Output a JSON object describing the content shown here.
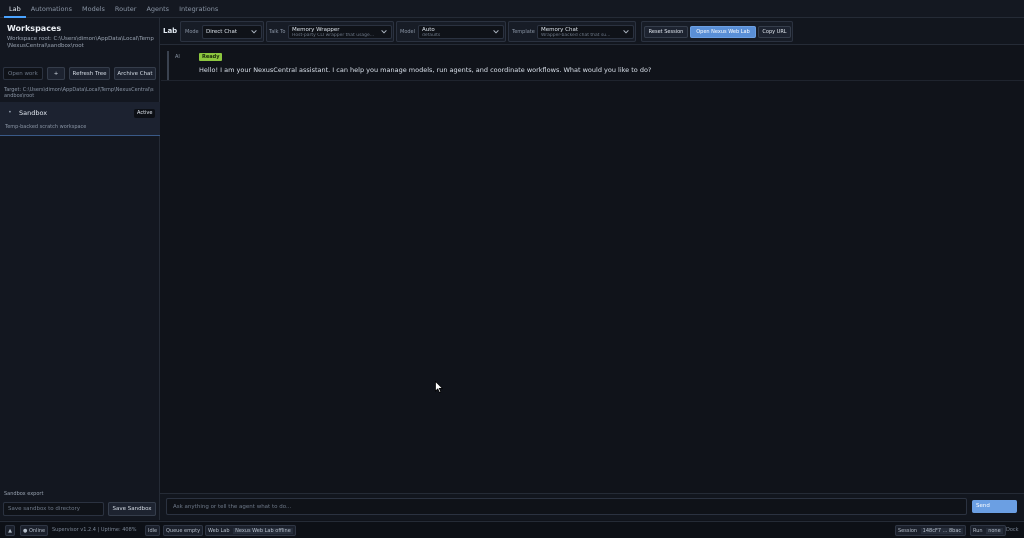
{
  "nav": {
    "tabs": [
      {
        "label": "Lab",
        "active": true
      },
      {
        "label": "Automations"
      },
      {
        "label": "Models"
      },
      {
        "label": "Router"
      },
      {
        "label": "Agents"
      },
      {
        "label": "Integrations"
      }
    ]
  },
  "sidebar": {
    "title": "Workspaces",
    "workspace_root": "Workspace root: C:\\Users\\dimon\\AppData\\Local\\Temp\\NexusCentral\\sandbox\\root",
    "open_workspace_placeholder": "Open work",
    "add_label": "+",
    "refresh_tree_label": "Refresh Tree",
    "archive_chat_label": "Archive Chat",
    "target": "Target: C:\\Users\\dimon\\AppData\\Local\\Temp\\NexusCentral\\sandbox\\root",
    "sandbox": {
      "bullet": "•",
      "name": "Sandbox",
      "status": "Active",
      "description": "Temp-backed scratch workspace"
    },
    "export_label": "Sandbox export",
    "save_dir_placeholder": "Save sandbox to directory",
    "save_sandbox_label": "Save Sandbox"
  },
  "toolbar": {
    "lab_label": "Lab",
    "mode": {
      "label": "Mode",
      "value": "Direct Chat"
    },
    "talk_to": {
      "label": "Talk To",
      "value": "Memory Wrapper",
      "sub": "Host-party CLI wrapper that usage..."
    },
    "model": {
      "label": "Model",
      "value": "Auto",
      "sub": "defaults"
    },
    "template": {
      "label": "Template",
      "value": "Memory Chat",
      "sub": "Wrapper-backed chat that su..."
    },
    "reset_session_label": "Reset Session",
    "open_web_lab_label": "Open Nexus Web Lab",
    "copy_url_label": "Copy URL"
  },
  "chat": {
    "messages": [
      {
        "sender": "AI",
        "badge": "Ready",
        "text": "Hello! I am your NexusCentral assistant. I can help you manage models, run agents, and coordinate workflows. What would you like to do?"
      }
    ]
  },
  "composer": {
    "placeholder": "Ask anything or tell the agent what to do...",
    "send_label": "Send"
  },
  "statusbar": {
    "toggle": "▲",
    "online": "● Online",
    "supervisor": "Supervisor v1.2.4 | Uptime: 408%",
    "idle": "Idle",
    "queue": "Queue empty",
    "web_lab_label": "Web Lab",
    "web_lab_status": "Nexus Web Lab offline",
    "session_label": "Session",
    "session_value": "148cF7 ... 8bac",
    "run_label": "Run",
    "run_value": "none",
    "dock_label": "Dock"
  },
  "colors": {
    "accent": "#4aa3ff",
    "primary_button": "#5a8fd6",
    "ready_badge": "#8dc73f",
    "background": "#10131a"
  }
}
